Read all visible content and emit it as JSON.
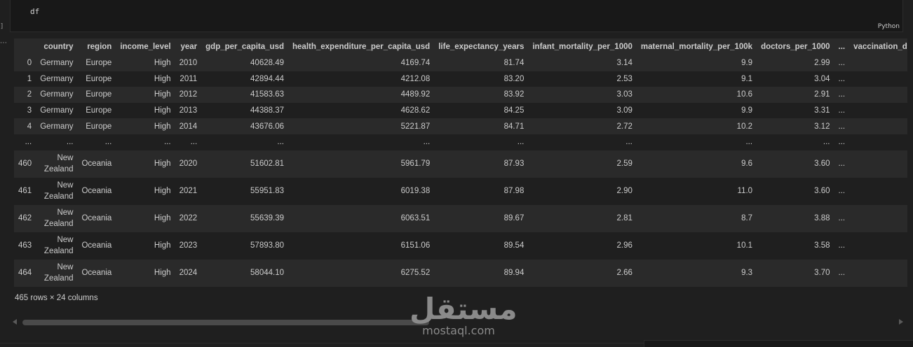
{
  "cell": {
    "code": "df",
    "language": "Python",
    "exec_marker": "]",
    "output_marker": "⋯"
  },
  "table": {
    "columns": [
      "",
      "country",
      "region",
      "income_level",
      "year",
      "gdp_per_capita_usd",
      "health_expenditure_per_capita_usd",
      "life_expectancy_years",
      "infant_mortality_per_1000",
      "maternal_mortality_per_100k",
      "doctors_per_1000",
      "...",
      "vaccination_dt"
    ],
    "rows": [
      [
        "0",
        "Germany",
        "Europe",
        "High",
        "2010",
        "40628.49",
        "4169.74",
        "81.74",
        "3.14",
        "9.9",
        "2.99",
        "..."
      ],
      [
        "1",
        "Germany",
        "Europe",
        "High",
        "2011",
        "42894.44",
        "4212.08",
        "83.20",
        "2.53",
        "9.1",
        "3.04",
        "..."
      ],
      [
        "2",
        "Germany",
        "Europe",
        "High",
        "2012",
        "41583.63",
        "4489.92",
        "83.92",
        "3.03",
        "10.6",
        "2.91",
        "..."
      ],
      [
        "3",
        "Germany",
        "Europe",
        "High",
        "2013",
        "44388.37",
        "4628.62",
        "84.25",
        "3.09",
        "9.9",
        "3.31",
        "..."
      ],
      [
        "4",
        "Germany",
        "Europe",
        "High",
        "2014",
        "43676.06",
        "5221.87",
        "84.71",
        "2.72",
        "10.2",
        "3.12",
        "..."
      ],
      [
        "...",
        "...",
        "...",
        "...",
        "...",
        "...",
        "...",
        "...",
        "...",
        "...",
        "...",
        "..."
      ],
      [
        "460",
        "New Zealand",
        "Oceania",
        "High",
        "2020",
        "51602.81",
        "5961.79",
        "87.93",
        "2.59",
        "9.6",
        "3.60",
        "..."
      ],
      [
        "461",
        "New Zealand",
        "Oceania",
        "High",
        "2021",
        "55951.83",
        "6019.38",
        "87.98",
        "2.90",
        "11.0",
        "3.60",
        "..."
      ],
      [
        "462",
        "New Zealand",
        "Oceania",
        "High",
        "2022",
        "55639.39",
        "6063.51",
        "89.67",
        "2.81",
        "8.7",
        "3.88",
        "..."
      ],
      [
        "463",
        "New Zealand",
        "Oceania",
        "High",
        "2023",
        "57893.80",
        "6151.06",
        "89.54",
        "2.96",
        "10.1",
        "3.58",
        "..."
      ],
      [
        "464",
        "New Zealand",
        "Oceania",
        "High",
        "2024",
        "58044.10",
        "6275.52",
        "89.94",
        "2.66",
        "9.3",
        "3.70",
        "..."
      ]
    ],
    "shape_text": "465 rows × 24 columns"
  },
  "watermark": {
    "arabic": "مستقل",
    "latin": "mostaql.com"
  },
  "icons": [
    "scroll-left-icon",
    "scroll-right-icon"
  ]
}
